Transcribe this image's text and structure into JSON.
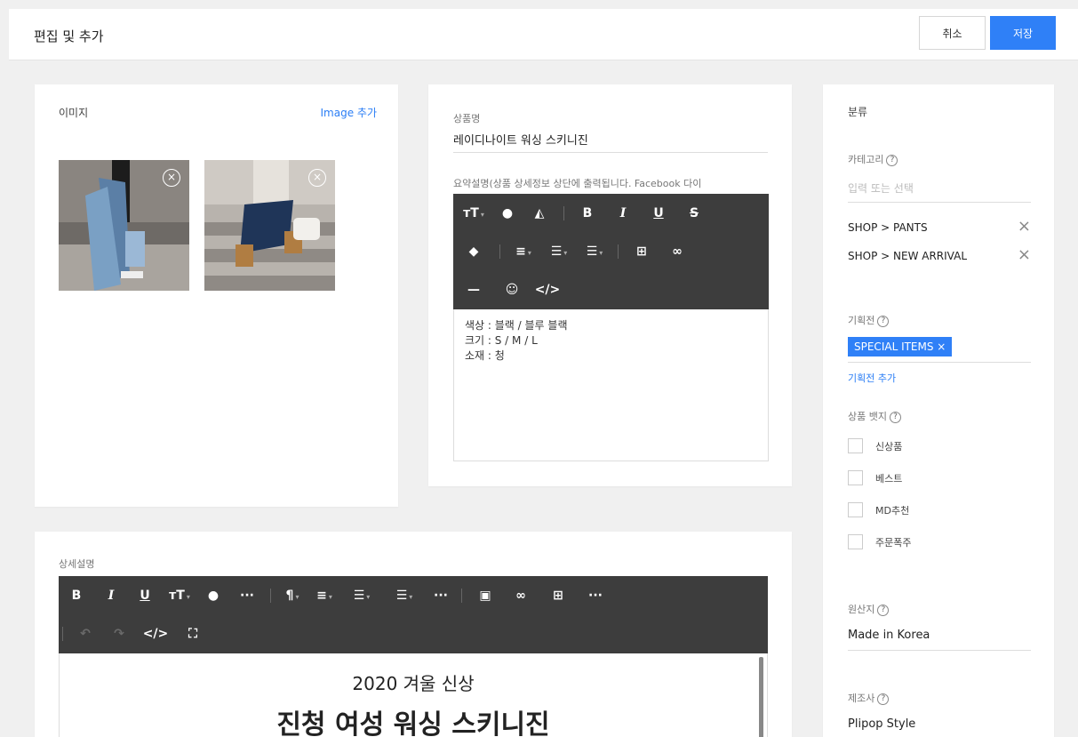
{
  "header": {
    "title": "편집 및 추가",
    "cancel_label": "취소",
    "save_label": "저장"
  },
  "image_section": {
    "label": "이미지",
    "add_label": "Image 추가",
    "remove_glyph": "×"
  },
  "product": {
    "name_label": "상품명",
    "name_value": "레이디나이트 워싱 스키니진",
    "summary_label": "요약설명(상품 상세정보 상단에 출력됩니다. Facebook 다이",
    "summary_lines": [
      "색상 : 블랙 / 블루 블랙",
      "크기 : S / M / L",
      "소재 : 청"
    ]
  },
  "detail": {
    "label": "상세설명",
    "heading1": "2020 겨울 신상",
    "heading2": "진청 여성 워싱 스키니진"
  },
  "side": {
    "title": "분류",
    "category_label": "카테고리",
    "category_placeholder": "입력 또는 선택",
    "categories": [
      "SHOP > PANTS",
      "SHOP > NEW ARRIVAL"
    ],
    "promo_label": "기획전",
    "promo_tag": "SPECIAL ITEMS ×",
    "promo_add": "기획전 추가",
    "badge_label": "상품 뱃지",
    "badges": [
      "신상품",
      "베스트",
      "MD추천",
      "주문폭주"
    ],
    "origin_label": "원산지",
    "origin_value": "Made in Korea",
    "maker_label": "제조사",
    "maker_value": "Plipop Style",
    "help_glyph": "?",
    "remove_glyph": "×"
  },
  "colors": {
    "accent": "#2f80f7",
    "toolbar": "#3d3d3d"
  }
}
